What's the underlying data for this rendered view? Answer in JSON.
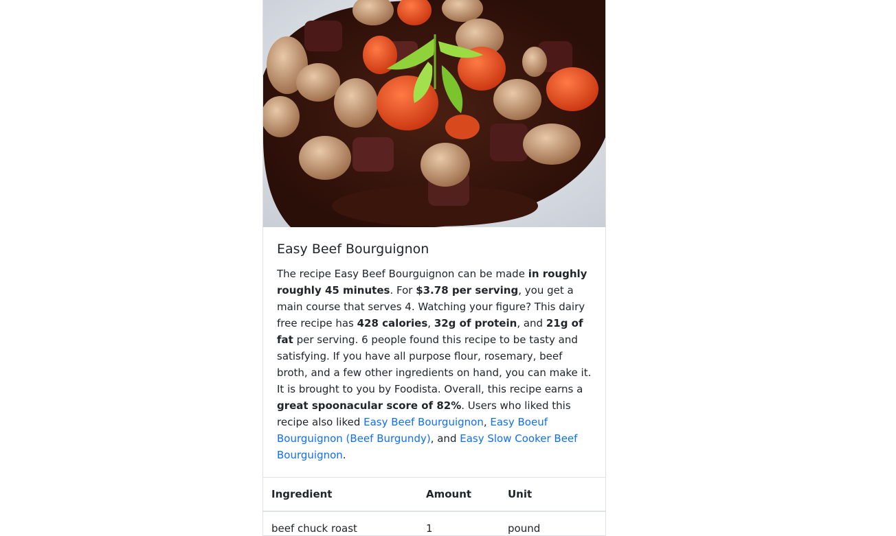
{
  "recipe": {
    "title": "Easy Beef Bourguignon",
    "image_alt": "Easy Beef Bourguignon",
    "summary": {
      "p1": "The recipe Easy Beef Bourguignon can be made ",
      "b1": "in roughly roughly 45 minutes",
      "p2": ". For ",
      "b2": "$3.78 per serving",
      "p3": ", you get a main course that serves 4. Watching your figure? This dairy free recipe has ",
      "b3": "428 calories",
      "p4": ", ",
      "b4": "32g of protein",
      "p5": ", and ",
      "b5": "21g of fat",
      "p6": " per serving. 6 people found this recipe to be tasty and satisfying. If you have all purpose flour, rosemary, beef broth, and a few other ingredients on hand, you can make it. It is brought to you by Foodista. Overall, this recipe earns a ",
      "b6": "great spoonacular score of 82%",
      "p7": ". Users who liked this recipe also liked ",
      "link1": "Easy Beef Bourguignon",
      "p8": ", ",
      "link2": "Easy Boeuf Bourguignon (Beef Burgundy)",
      "p9": ", and ",
      "link3": "Easy Slow Cooker Beef Bourguignon",
      "p10": "."
    }
  },
  "table": {
    "headers": [
      "Ingredient",
      "Amount",
      "Unit"
    ],
    "rows": [
      [
        "beef chuck roast",
        "1",
        "pound"
      ]
    ]
  }
}
